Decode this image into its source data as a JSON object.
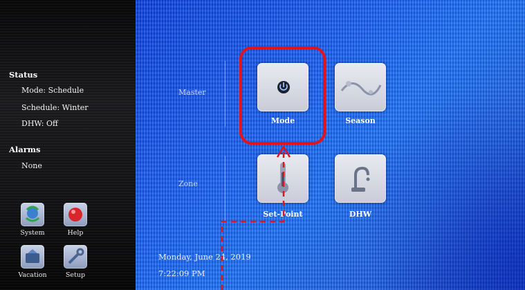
{
  "status": {
    "heading": "Status",
    "mode": "Mode: Schedule",
    "schedule": "Schedule: Winter",
    "dhw": "DHW: Off"
  },
  "alarms": {
    "heading": "Alarms",
    "value": "None"
  },
  "nav_buttons": [
    {
      "label": "System",
      "icon": "system-icon"
    },
    {
      "label": "Help",
      "icon": "help-icon"
    },
    {
      "label": "Vacation",
      "icon": "vacation-icon"
    },
    {
      "label": "Setup",
      "icon": "setup-icon"
    }
  ],
  "rows": {
    "master": "Master",
    "zone": "Zone"
  },
  "tiles": [
    {
      "label": "Mode",
      "icon": "power-icon"
    },
    {
      "label": "Season",
      "icon": "season-icon"
    },
    {
      "label": "Set-Point",
      "icon": "thermometer-icon"
    },
    {
      "label": "DHW",
      "icon": "faucet-icon"
    }
  ],
  "datetime": {
    "date": "Monday, June 24, 2019",
    "time": "7:22:09 PM"
  },
  "colors": {
    "highlight": "#e0141d",
    "background_blue": "#1a6ef6",
    "sidebar": "#121214"
  }
}
